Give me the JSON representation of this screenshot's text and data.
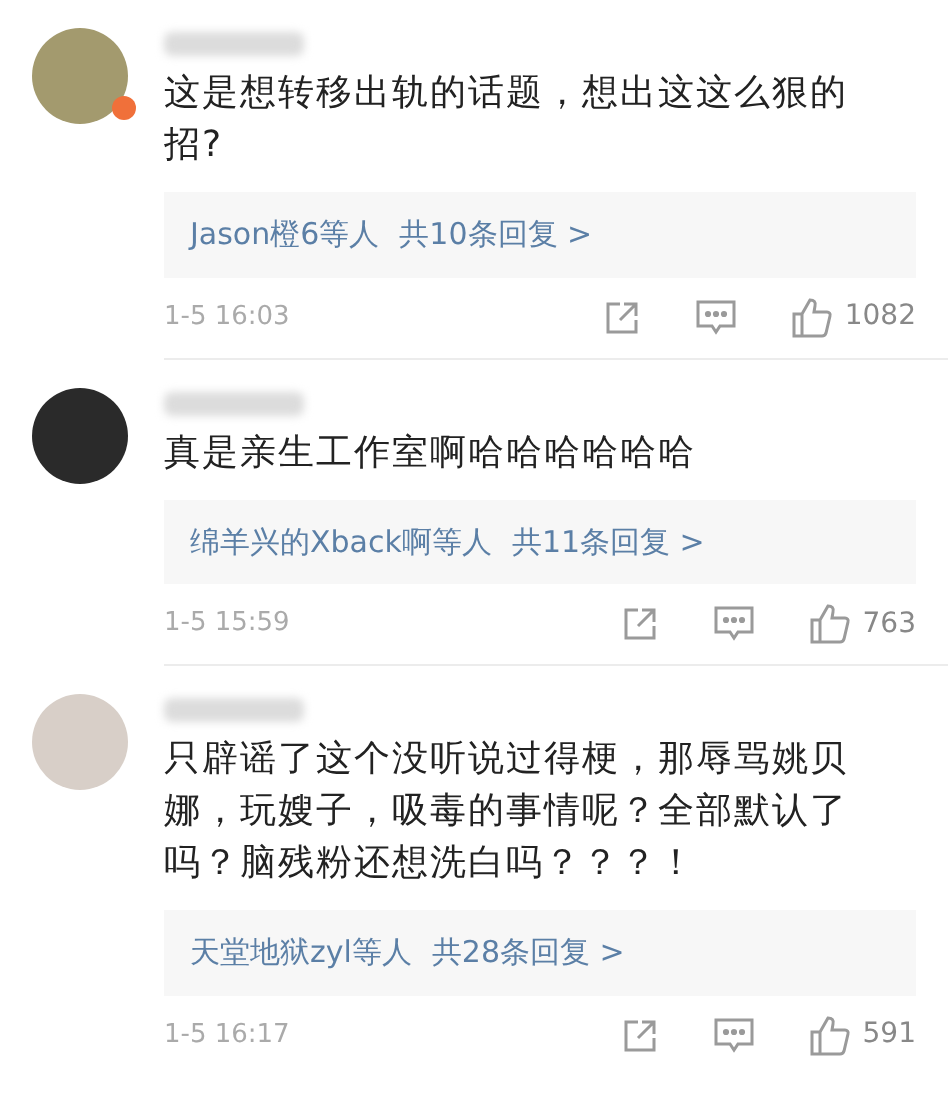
{
  "comments": [
    {
      "color": "#a39a6e",
      "badge": true,
      "text": "这是想转移出轨的话题，想出这这么狠的招?",
      "replies_by": "Jason橙6等人",
      "replies_count": "共10条回复 >",
      "time": "1-5 16:03",
      "likes": "1082"
    },
    {
      "color": "#2a2a2a",
      "badge": false,
      "text": "真是亲生工作室啊哈哈哈哈哈哈",
      "replies_by": "绵羊兴的Xback啊等人",
      "replies_count": "共11条回复 >",
      "time": "1-5 15:59",
      "likes": "763"
    },
    {
      "color": "#d8cfc8",
      "badge": false,
      "text": "只辟谣了这个没听说过得梗，那辱骂姚贝娜，玩嫂子，吸毒的事情呢？全部默认了吗？脑残粉还想洗白吗？？？！",
      "replies_by": "天堂地狱zyl等人",
      "replies_count": "共28条回复 >",
      "time": "1-5 16:17",
      "likes": "591"
    }
  ]
}
